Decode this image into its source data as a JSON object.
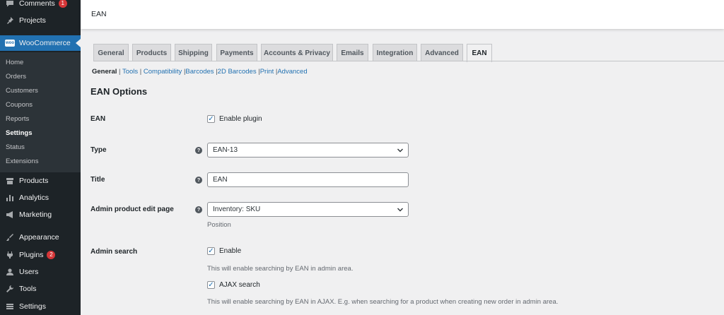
{
  "sidebar": {
    "menu": [
      {
        "label": "Comments",
        "icon": "comment-icon",
        "badge": "1"
      },
      {
        "label": "Projects",
        "icon": "pin-icon"
      },
      {
        "label": "WooCommerce",
        "icon": "woocommerce-icon"
      },
      {
        "label": "Products",
        "icon": "archive-icon"
      },
      {
        "label": "Analytics",
        "icon": "bar-chart-icon"
      },
      {
        "label": "Marketing",
        "icon": "megaphone-icon"
      },
      {
        "label": "Appearance",
        "icon": "paintbrush-icon"
      },
      {
        "label": "Plugins",
        "icon": "plug-icon",
        "badge": "2"
      },
      {
        "label": "Users",
        "icon": "user-icon"
      },
      {
        "label": "Tools",
        "icon": "wrench-icon"
      },
      {
        "label": "Settings",
        "icon": "settings-icon"
      }
    ],
    "wc_logo": "woo",
    "submenu": [
      "Home",
      "Orders",
      "Customers",
      "Coupons",
      "Reports",
      "Settings",
      "Status",
      "Extensions"
    ],
    "submenu_current": "Settings"
  },
  "header": {
    "title": "EAN"
  },
  "tabs": [
    "General",
    "Products",
    "Shipping",
    "Payments",
    "Accounts & Privacy",
    "Emails",
    "Integration",
    "Advanced",
    "EAN"
  ],
  "active_tab": "EAN",
  "subnav": [
    {
      "label": "General",
      "current": true
    },
    {
      "label": "Tools"
    },
    {
      "label": "Compatibility"
    },
    {
      "label": "Barcodes"
    },
    {
      "label": "2D Barcodes"
    },
    {
      "label": "Print"
    },
    {
      "label": "Advanced"
    }
  ],
  "section_title": "EAN Options",
  "form": {
    "ean": {
      "label": "EAN",
      "checkbox_label": "Enable plugin",
      "checked": true
    },
    "type": {
      "label": "Type",
      "value": "EAN-13"
    },
    "title": {
      "label": "Title",
      "value": "EAN"
    },
    "admin_edit": {
      "label": "Admin product edit page",
      "value": "Inventory: SKU",
      "description": "Position"
    },
    "admin_search": {
      "label": "Admin search",
      "enable_label": "Enable",
      "enable_checked": true,
      "enable_desc": "This will enable searching by EAN in admin area.",
      "ajax_label": "AJAX search",
      "ajax_checked": true,
      "ajax_desc": "This will enable searching by EAN in AJAX. E.g. when searching for a product when creating new order in admin area."
    },
    "help_glyph": "?"
  },
  "colors": {
    "sidebar_bg": "#1d2327",
    "accent": "#2271b1",
    "badge": "#d63638",
    "page_bg": "#f0f0f1"
  }
}
